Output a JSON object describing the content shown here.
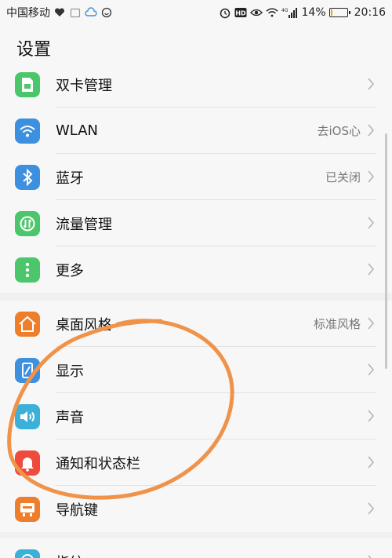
{
  "status_bar": {
    "carrier": "中国移动",
    "battery_percent": "14%",
    "battery_level": 0.14,
    "time": "20:16",
    "network": "4G",
    "icons": [
      "heart-icon",
      "calendar-icon",
      "cloud-icon",
      "happy-face-icon",
      "alarm-icon",
      "hd-icon",
      "eye-icon",
      "wifi-icon",
      "signal-icon",
      "battery-icon"
    ]
  },
  "header": {
    "title": "设置"
  },
  "groups": [
    {
      "items": [
        {
          "label": "双卡管理",
          "value": "",
          "icon": "sim-card-icon",
          "color": "#4cc66a"
        },
        {
          "label": "WLAN",
          "value": "去iOS心",
          "icon": "wifi-icon",
          "color": "#3d8fe0"
        },
        {
          "label": "蓝牙",
          "value": "已关闭",
          "icon": "bluetooth-icon",
          "color": "#3d8fe0"
        },
        {
          "label": "流量管理",
          "value": "",
          "icon": "data-traffic-icon",
          "color": "#4cc66a"
        },
        {
          "label": "更多",
          "value": "",
          "icon": "more-icon",
          "color": "#4cc66a"
        }
      ]
    },
    {
      "items": [
        {
          "label": "桌面风格",
          "value": "标准风格",
          "icon": "home-icon",
          "color": "#ef7e2b"
        },
        {
          "label": "显示",
          "value": "",
          "icon": "display-icon",
          "color": "#3d8fe0"
        },
        {
          "label": "声音",
          "value": "",
          "icon": "speaker-icon",
          "color": "#3bb0d8"
        },
        {
          "label": "通知和状态栏",
          "value": "",
          "icon": "bell-icon",
          "color": "#ee4a3d"
        },
        {
          "label": "导航键",
          "value": "",
          "icon": "navigation-key-icon",
          "color": "#ef7e2b"
        }
      ]
    },
    {
      "items": [
        {
          "label": "指纹",
          "value": "",
          "icon": "fingerprint-icon",
          "color": "#3bb0d8"
        }
      ]
    }
  ],
  "colors": {
    "annotation": "#f0934a",
    "background": "#f7f7f7",
    "separator": "#f0f0f0"
  }
}
